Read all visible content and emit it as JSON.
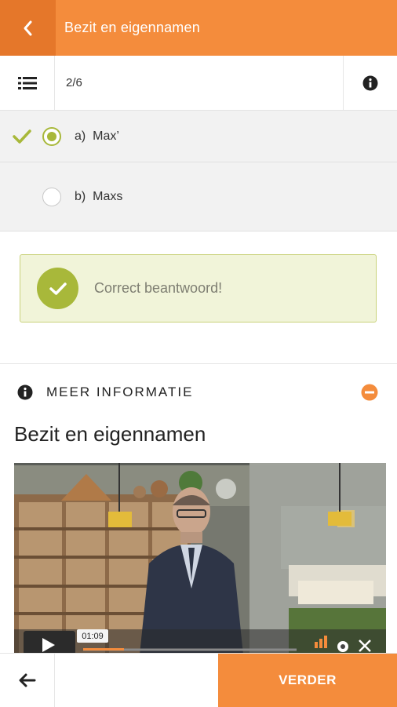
{
  "header": {
    "title": "Bezit en eigennamen"
  },
  "question": {
    "progress": "2/6"
  },
  "options": [
    {
      "letter": "a)",
      "text": "Max’",
      "selected": true,
      "correct": true
    },
    {
      "letter": "b)",
      "text": "Maxs",
      "selected": false,
      "correct": false
    }
  ],
  "feedback": {
    "message": "Correct beantwoord!"
  },
  "info": {
    "section_label": "MEER INFORMATIE",
    "heading": "Bezit en eigennamen"
  },
  "video": {
    "timestamp": "01:09",
    "progress": 0.19
  },
  "footer": {
    "next_label": "VERDER"
  },
  "colors": {
    "accent": "#f48c3c",
    "success": "#a8b83a"
  }
}
